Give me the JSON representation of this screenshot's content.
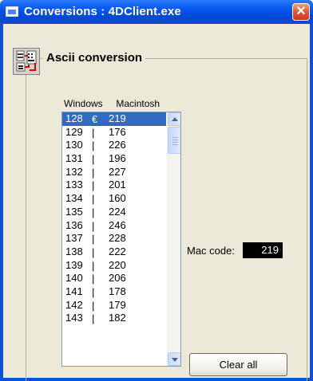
{
  "window": {
    "title": "Conversions : 4DClient.exe",
    "close_glyph": "✕"
  },
  "group": {
    "title": "Ascii conversion"
  },
  "columns": {
    "windows": "Windows",
    "macintosh": "Macintosh"
  },
  "list": {
    "rows": [
      {
        "win": "128",
        "sep": "€",
        "mac": "219",
        "selected": true
      },
      {
        "win": "129",
        "sep": "|",
        "mac": "176"
      },
      {
        "win": "130",
        "sep": "|",
        "mac": "226"
      },
      {
        "win": "131",
        "sep": "|",
        "mac": "196"
      },
      {
        "win": "132",
        "sep": "|",
        "mac": "227"
      },
      {
        "win": "133",
        "sep": "|",
        "mac": "201"
      },
      {
        "win": "134",
        "sep": "|",
        "mac": "160"
      },
      {
        "win": "135",
        "sep": "|",
        "mac": "224"
      },
      {
        "win": "136",
        "sep": "|",
        "mac": "246"
      },
      {
        "win": "137",
        "sep": "|",
        "mac": "228"
      },
      {
        "win": "138",
        "sep": "|",
        "mac": "222"
      },
      {
        "win": "139",
        "sep": "|",
        "mac": "220"
      },
      {
        "win": "140",
        "sep": "|",
        "mac": "206"
      },
      {
        "win": "141",
        "sep": "|",
        "mac": "178"
      },
      {
        "win": "142",
        "sep": "|",
        "mac": "179"
      },
      {
        "win": "143",
        "sep": "|",
        "mac": "182"
      }
    ]
  },
  "mac_code": {
    "label": "Mac code:",
    "value": "219"
  },
  "buttons": {
    "clear_all": "Clear all"
  },
  "colors": {
    "title_bar": "#0a5cf0",
    "selection": "#316ac5",
    "dialog_background": "#ece9d8",
    "mac_code_field": "#000000"
  },
  "icons": {
    "app": "window-icon",
    "group": "ascii-conversion-icon",
    "close": "close-icon"
  }
}
